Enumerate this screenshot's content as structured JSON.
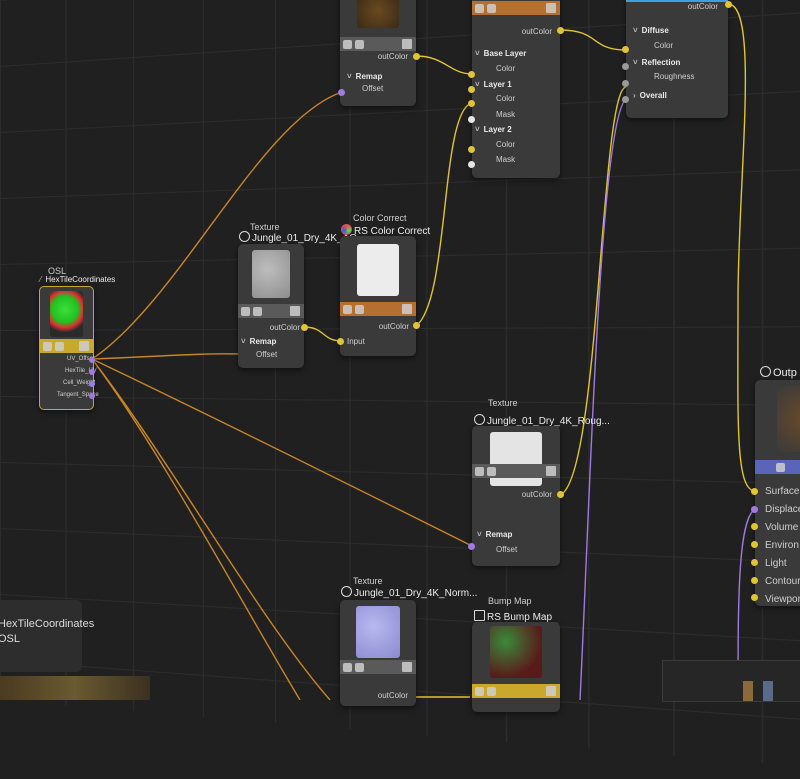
{
  "colors": {
    "wire_orange": "#c7852a",
    "wire_yellow": "#e0c434",
    "wire_purple": "#a07ae0",
    "bar_gray": "#5a5a5a",
    "bar_brown": "#b56f2e",
    "bar_yellow": "#c9a82c",
    "bar_blue": "#5a64b8",
    "bar_accent": "#3aa0e0"
  },
  "hex": {
    "subtitle": "OSL",
    "title": "HexTileCoordinates",
    "ports": [
      "UV_Offset",
      "HexTile_UV",
      "Cell_Weight",
      "Tangent_Space"
    ]
  },
  "tex_top": {
    "out": "outColor",
    "remap": "Remap",
    "offset": "Offset"
  },
  "layer": {
    "out": "outColor",
    "base": "Base Layer",
    "base_color": "Color",
    "l1": "Layer 1",
    "l1_color": "Color",
    "l1_mask": "Mask",
    "l2": "Layer 2",
    "l2_color": "Color",
    "l2_mask": "Mask"
  },
  "material": {
    "out": "outColor",
    "diffuse": "Diffuse",
    "diffuse_color": "Color",
    "reflection": "Reflection",
    "roughness": "Roughness",
    "overall": "Overall"
  },
  "ao": {
    "subtitle": "Texture",
    "title": "Jungle_01_Dry_4K_AO",
    "out": "outColor",
    "remap": "Remap",
    "offset": "Offset"
  },
  "cc": {
    "subtitle": "Color Correct",
    "title": "RS Color Correct",
    "out": "outColor",
    "input": "Input"
  },
  "rough": {
    "subtitle": "Texture",
    "title": "Jungle_01_Dry_4K_Roug...",
    "out": "outColor",
    "remap": "Remap",
    "offset": "Offset"
  },
  "normal": {
    "subtitle": "Texture",
    "title": "Jungle_01_Dry_4K_Norm...",
    "out": "outColor"
  },
  "bump": {
    "subtitle": "Bump Map",
    "title": "RS Bump Map"
  },
  "output": {
    "title": "Outp",
    "ports": [
      "Surface",
      "Displace",
      "Volume",
      "Environ",
      "Light",
      "Contour",
      "Viewpor"
    ]
  },
  "panel": {
    "title": "HexTileCoordinates",
    "subtitle": "OSL"
  }
}
